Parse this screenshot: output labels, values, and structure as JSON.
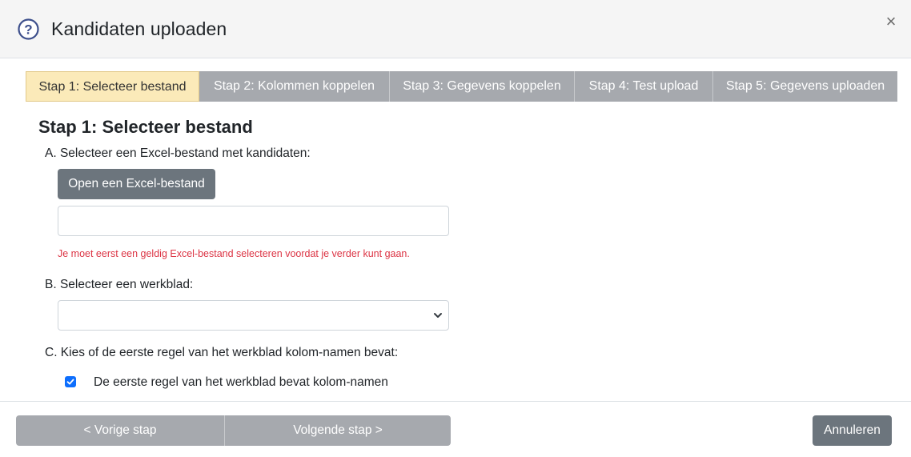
{
  "header": {
    "title": "Kandidaten uploaden",
    "help_icon": "question-circle-icon",
    "close_label": "×"
  },
  "tabs": [
    {
      "label": "Stap 1: Selecteer bestand",
      "active": true
    },
    {
      "label": "Stap 2: Kolommen koppelen",
      "active": false
    },
    {
      "label": "Stap 3: Gegevens koppelen",
      "active": false
    },
    {
      "label": "Stap 4: Test upload",
      "active": false
    },
    {
      "label": "Stap 5: Gegevens uploaden",
      "active": false
    }
  ],
  "step": {
    "title": "Stap 1: Selecteer bestand",
    "section_a_label": "A. Selecteer een Excel-bestand met kandidaten:",
    "open_button_label": "Open een Excel-bestand",
    "file_value": "",
    "error_text": "Je moet eerst een geldig Excel-bestand selecteren voordat je verder kunt gaan.",
    "section_b_label": "B. Selecteer een werkblad:",
    "sheet_selected": "",
    "section_c_label": "C. Kies of de eerste regel van het werkblad kolom-namen bevat:",
    "checkbox_label": "De eerste regel van het werkblad bevat kolom-namen",
    "checkbox_checked": true
  },
  "footer": {
    "prev_label": "< Vorige stap",
    "next_label": "Volgende stap >",
    "cancel_label": "Annuleren"
  },
  "colors": {
    "active_tab": "#fbeab9",
    "inactive_tab": "#a6a9ae",
    "secondary_button": "#6c757d",
    "error": "#dc3545",
    "checkbox": "#0d6efd",
    "help_icon": "#3d4f8c"
  }
}
